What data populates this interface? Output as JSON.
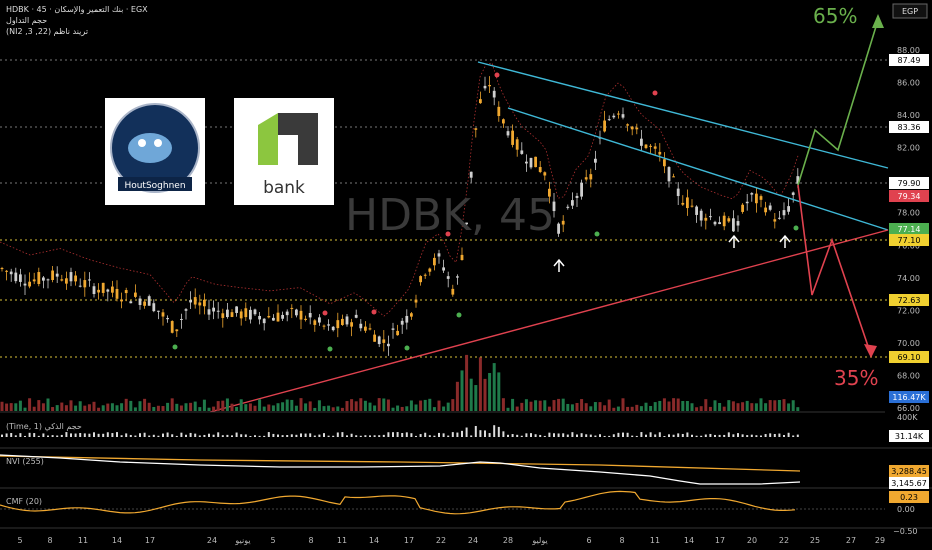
{
  "header": {
    "symbol_line": "HDBK · 45 · بنك التعمير والإسكان · EGX",
    "volume_label": "حجم التداول",
    "indicator_line": "(NI2 ,3 ,22) تريند ناظم"
  },
  "currency_badge": "EGP",
  "watermark": "HDBK, 45",
  "logos": {
    "left_text": "HoutSoghnen",
    "right_text": "bank"
  },
  "annotations": {
    "up_target": "65%",
    "down_target": "35%"
  },
  "colors": {
    "up_arrow": "#6ab04c",
    "down_arrow": "#e0424f",
    "resistance_line": "#3fb8d6",
    "support_line": "#e0424f",
    "candle_up": "#f0a830",
    "candle_down": "#cfcfcf"
  },
  "price_axis": {
    "ticks": [
      "88.00",
      "86.00",
      "84.00",
      "82.00",
      "80.00",
      "78.00",
      "76.00",
      "74.00",
      "72.00",
      "70.00",
      "68.00",
      "66.00"
    ],
    "levels": [
      {
        "value": "87.49",
        "kind": "white"
      },
      {
        "value": "83.36",
        "kind": "white"
      },
      {
        "value": "79.90",
        "kind": "white"
      },
      {
        "value": "79.34",
        "kind": "red"
      },
      {
        "value": "77.14",
        "kind": "green"
      },
      {
        "value": "77.10",
        "kind": "yellow"
      },
      {
        "value": "72.63",
        "kind": "yellow"
      },
      {
        "value": "69.10",
        "kind": "yellow"
      },
      {
        "value": "116.47K",
        "kind": "blue"
      }
    ]
  },
  "panes": {
    "volume_time": {
      "label": "(Time, 1) حجم الذكي",
      "tick": "400K",
      "value": "31.14K"
    },
    "nvi": {
      "label": "NVI (255)",
      "value1": "3,288.45",
      "value2": "3,145.67"
    },
    "cmf": {
      "label": "CMF (20)",
      "value": "0.23",
      "tick0": "0.00",
      "tick1": "−0.50"
    }
  },
  "time_axis": [
    "5",
    "8",
    "11",
    "14",
    "17",
    "يونيو",
    "24",
    "5",
    "8",
    "11",
    "14",
    "17",
    "22",
    "24",
    "28",
    "يوليو",
    "6",
    "8",
    "11",
    "14",
    "17",
    "20",
    "22",
    "25",
    "27",
    "29"
  ]
}
